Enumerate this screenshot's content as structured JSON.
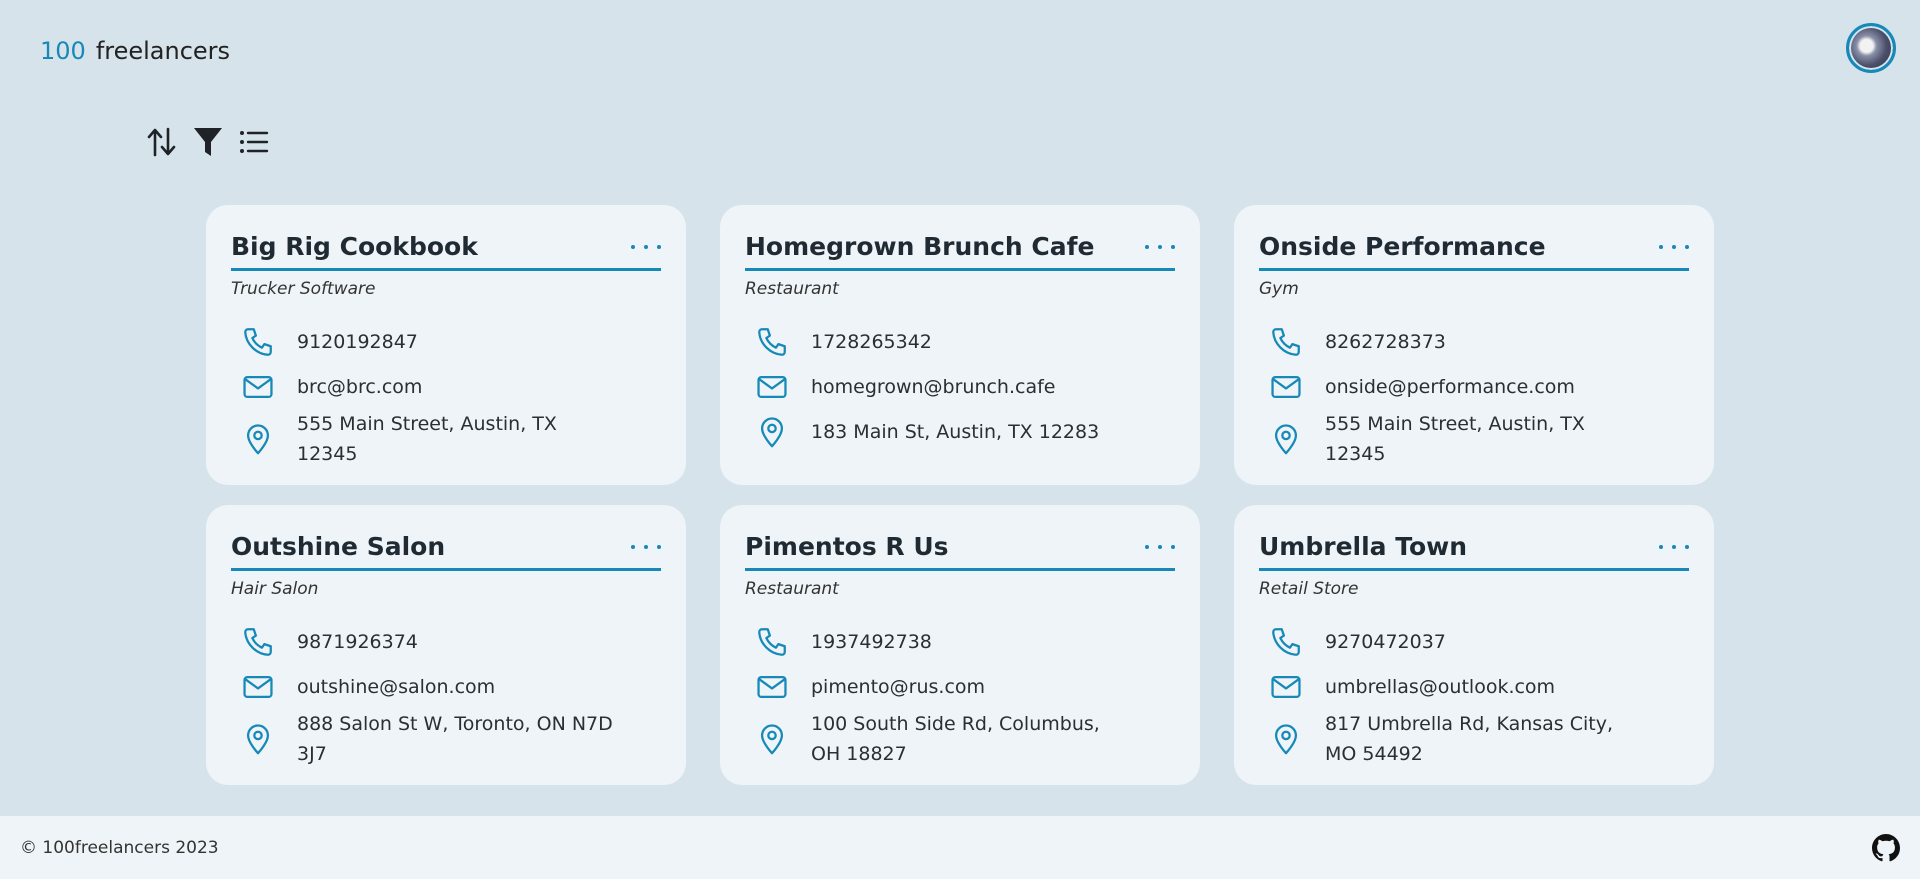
{
  "header": {
    "brand_number": "100",
    "brand_word": "freelancers"
  },
  "toolbar": {
    "sort_icon": "sort-arrows-icon",
    "filter_icon": "filter-funnel-icon",
    "list_icon": "list-view-icon"
  },
  "colors": {
    "accent": "#1689b8",
    "background": "#d6e3eb",
    "card": "#eef4f7"
  },
  "cards": [
    {
      "name": "Big Rig Cookbook",
      "type": "Trucker Software",
      "phone": "9120192847",
      "email": "brc@brc.com",
      "address": "555 Main Street, Austin, TX 12345"
    },
    {
      "name": "Homegrown Brunch Cafe",
      "type": "Restaurant",
      "phone": "1728265342",
      "email": "homegrown@brunch.cafe",
      "address": "183 Main St, Austin, TX 12283"
    },
    {
      "name": "Onside Performance",
      "type": "Gym",
      "phone": "8262728373",
      "email": "onside@performance.com",
      "address": "555 Main Street, Austin, TX 12345"
    },
    {
      "name": "Outshine Salon",
      "type": "Hair Salon",
      "phone": "9871926374",
      "email": "outshine@salon.com",
      "address": "888 Salon St W, Toronto, ON N7D 3J7"
    },
    {
      "name": "Pimentos R Us",
      "type": "Restaurant",
      "phone": "1937492738",
      "email": "pimento@rus.com",
      "address": "100 South Side Rd, Columbus, OH 18827"
    },
    {
      "name": "Umbrella Town",
      "type": "Retail Store",
      "phone": "9270472037",
      "email": "umbrellas@outlook.com",
      "address": "817 Umbrella Rd, Kansas City, MO 54492"
    }
  ],
  "footer": {
    "copyright": "© 100freelancers 2023",
    "github_icon": "github-icon"
  }
}
